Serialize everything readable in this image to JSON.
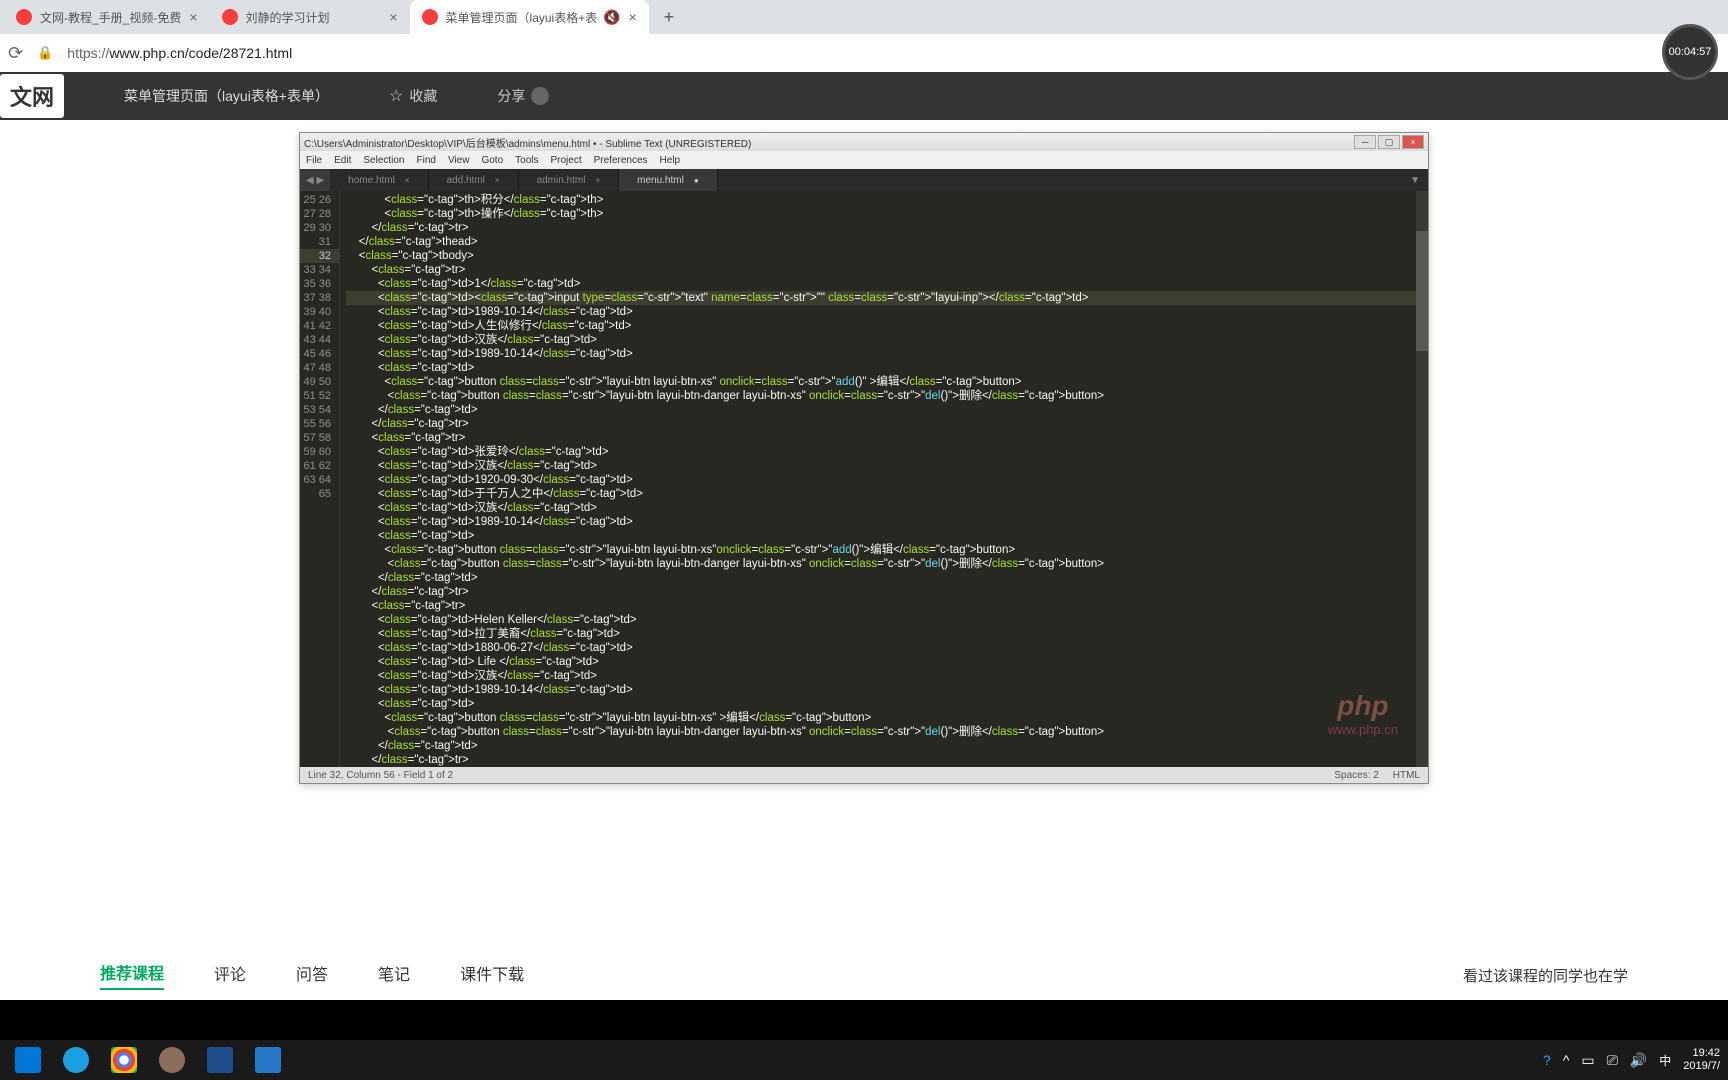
{
  "browser": {
    "tabs": [
      {
        "icon": "php",
        "title": "文网-教程_手册_视频-免费"
      },
      {
        "icon": "php",
        "title": "刘静的学习计划"
      },
      {
        "icon": "php",
        "title": "菜单管理页面（layui表格+表",
        "muted": true,
        "active": true
      }
    ],
    "url_proto": "https://",
    "url": "www.php.cn/code/28721.html",
    "timer": "00:04:57"
  },
  "site": {
    "logo": "文网",
    "breadcrumb": "菜单管理页面（layui表格+表单）",
    "fav": "收藏",
    "share": "分享"
  },
  "sublime": {
    "title": "C:\\Users\\Administrator\\Desktop\\VIP\\后台模板\\admins\\menu.html • - Sublime Text (UNREGISTERED)",
    "menu": [
      "File",
      "Edit",
      "Selection",
      "Find",
      "View",
      "Goto",
      "Tools",
      "Project",
      "Preferences",
      "Help"
    ],
    "tabs": [
      "home.html",
      "add.html",
      "admin.html",
      "menu.html"
    ],
    "active_tab": 3,
    "status_left": "Line 32, Column 56 - Field 1 of 2",
    "status_spaces": "Spaces: 2",
    "status_lang": "HTML",
    "line_start": 25,
    "line_end": 65,
    "highlight_line": 32
  },
  "code_lines": [
    "            <th>积分</th>",
    "            <th>操作</th>",
    "        </tr>",
    "    </thead>",
    "    <tbody>",
    "        <tr>",
    "          <td>1</td>",
    "          <td><input type=\"text\" name=\"\" class=\"layui-inp\"></td>",
    "          <td>1989-10-14</td>",
    "          <td>人生似修行</td>",
    "          <td>汉族</td>",
    "          <td>1989-10-14</td>",
    "          <td>",
    "            <button class=\"layui-btn layui-btn-xs\" onclick=\"add()\" >编辑</button>",
    "             <button class=\"layui-btn layui-btn-danger layui-btn-xs\" onclick=\"del()\">删除</button>",
    "          </td>",
    "        </tr>",
    "        <tr>",
    "          <td>张爱玲</td>",
    "          <td>汉族</td>",
    "          <td>1920-09-30</td>",
    "          <td>于千万人之中</td>",
    "          <td>汉族</td>",
    "          <td>1989-10-14</td>",
    "          <td>",
    "            <button class=\"layui-btn layui-btn-xs\"onclick=\"add()\">编辑</button>",
    "             <button class=\"layui-btn layui-btn-danger layui-btn-xs\" onclick=\"del()\">删除</button>",
    "          </td>",
    "        </tr>",
    "        <tr>",
    "          <td>Helen Keller</td>",
    "          <td>拉丁美裔</td>",
    "          <td>1880-06-27</td>",
    "          <td> Life </td>",
    "          <td>汉族</td>",
    "          <td>1989-10-14</td>",
    "          <td>",
    "            <button class=\"layui-btn layui-btn-xs\" >编辑</button>",
    "             <button class=\"layui-btn layui-btn-danger layui-btn-xs\" onclick=\"del()\">删除</button>",
    "          </td>",
    "        </tr>"
  ],
  "page_tabs": [
    "推荐课程",
    "评论",
    "问答",
    "笔记",
    "课件下载"
  ],
  "related": "看过该课程的同学也在学",
  "watermark": {
    "brand": "php",
    "url": "www.php.cn"
  },
  "taskbar": {
    "tray_lang": "中",
    "time": "19:42",
    "date": "2019/7/"
  }
}
